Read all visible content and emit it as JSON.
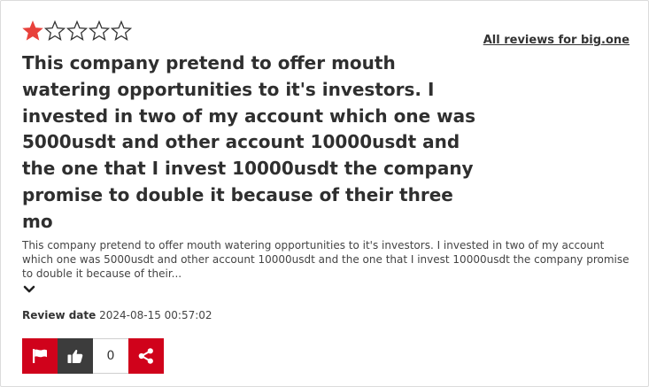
{
  "review": {
    "rating": 1,
    "max_rating": 5,
    "title": "This company pretend to offer mouth watering opportunities to it's investors. I invested in two of my account which one was 5000usdt and other account 10000usdt and the one that I invest 10000usdt the company promise to double it because of their three mo",
    "body_excerpt": "This company pretend to offer mouth watering opportunities to it's investors. I invested in two of my account which one was 5000usdt and other account 10000usdt and the one that I invest 10000usdt the company promise to double it because of their...",
    "date_label": "Review date",
    "date_value": "2024-08-15 00:57:02"
  },
  "links": {
    "all_reviews": "All reviews for big.one"
  },
  "actions": {
    "like_count": "0"
  },
  "icons": {
    "star_filled": "star-filled-icon",
    "star_empty": "star-outline-icon",
    "expand": "chevron-down-icon",
    "flag": "flag-icon",
    "like": "thumbs-up-icon",
    "share": "share-icon"
  },
  "colors": {
    "star_filled": "#e8413b",
    "star_outline": "#333333",
    "flag_button": "#d0021b",
    "like_button": "#3c3c3c",
    "share_button": "#d0021b"
  }
}
